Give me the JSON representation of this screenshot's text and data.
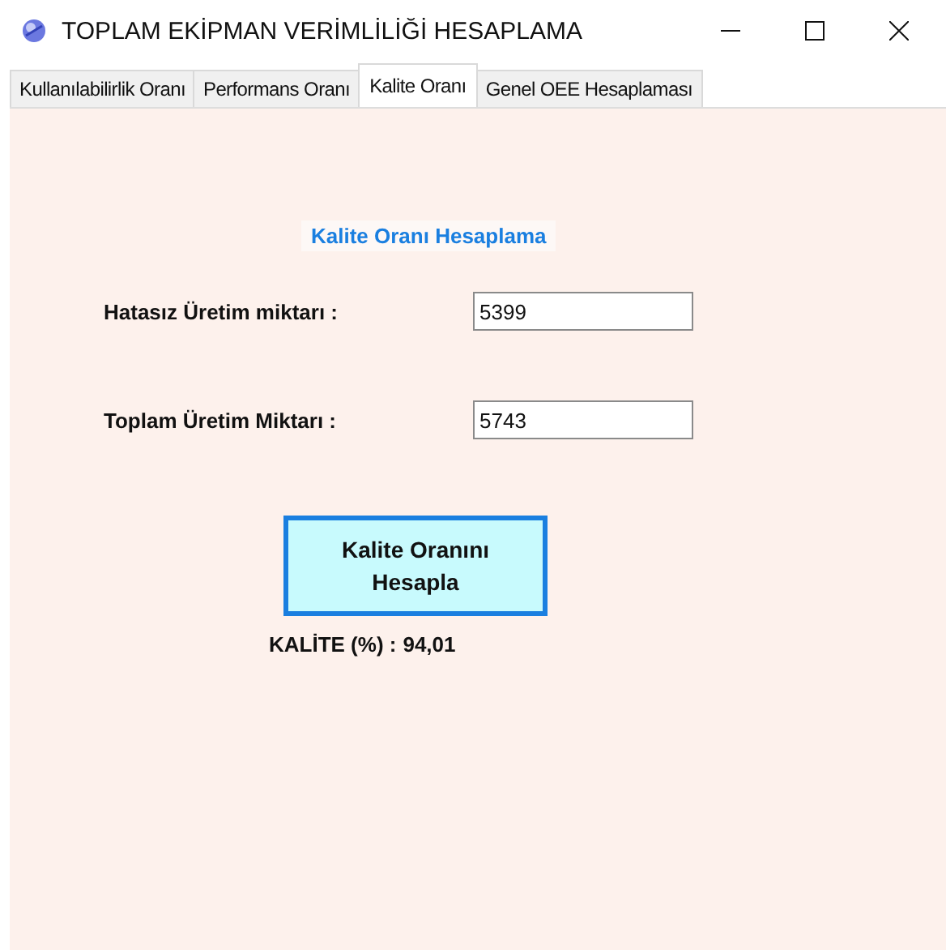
{
  "window": {
    "title": "TOPLAM EKİPMAN VERİMLİLİĞİ HESAPLAMA"
  },
  "tabs": [
    {
      "label": "Kullanılabilirlik Oranı",
      "selected": false
    },
    {
      "label": "Performans Oranı",
      "selected": false
    },
    {
      "label": "Kalite Oranı",
      "selected": true
    },
    {
      "label": "Genel OEE Hesaplaması",
      "selected": false
    }
  ],
  "panel": {
    "heading": "Kalite Oranı Hesaplama",
    "fields": [
      {
        "label": "Hatasız Üretim miktarı :",
        "value": "5399"
      },
      {
        "label": "Toplam Üretim Miktarı :",
        "value": "5743"
      }
    ],
    "button": "Kalite Oranını Hesapla",
    "result": {
      "label": "KALİTE (%) :",
      "value": "94,01"
    }
  }
}
